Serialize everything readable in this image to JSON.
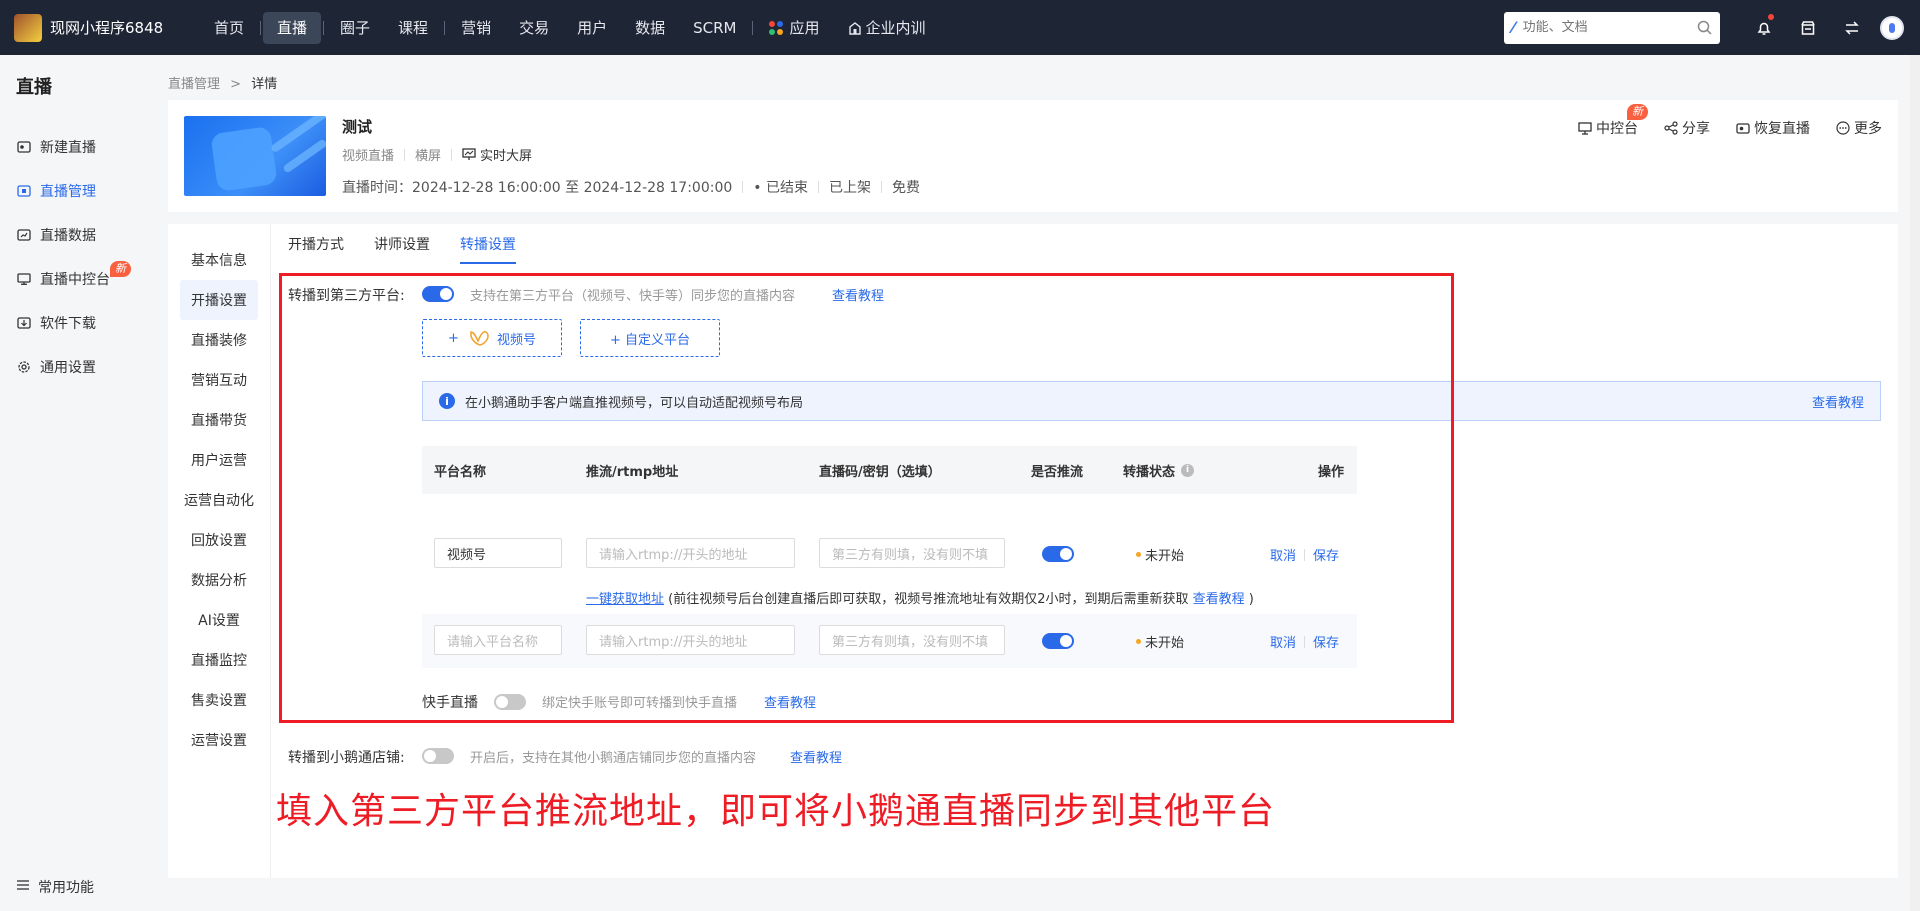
{
  "topbar": {
    "brand": "现网小程序6848",
    "nav": [
      {
        "label": "首页"
      },
      {
        "label": "直播",
        "active": true
      },
      {
        "label": "圈子"
      },
      {
        "label": "课程"
      },
      {
        "label": "营销"
      },
      {
        "label": "交易"
      },
      {
        "label": "用户"
      },
      {
        "label": "数据"
      },
      {
        "label": "SCRM"
      },
      {
        "label": "应用"
      },
      {
        "label": "企业内训"
      }
    ],
    "search_placeholder": "功能、文档"
  },
  "sidebar": {
    "title": "直播",
    "items": [
      {
        "label": "新建直播",
        "icon": "video-camera-icon"
      },
      {
        "label": "直播管理",
        "icon": "manage-icon",
        "active": true
      },
      {
        "label": "直播数据",
        "icon": "chart-icon"
      },
      {
        "label": "直播中控台",
        "icon": "monitor-icon",
        "badge": "新"
      },
      {
        "label": "软件下载",
        "icon": "download-icon"
      },
      {
        "label": "通用设置",
        "icon": "gear-icon"
      }
    ],
    "bottom": "常用功能"
  },
  "breadcrumb": {
    "parent": "直播管理",
    "sep": ">",
    "current": "详情"
  },
  "live": {
    "title": "测试",
    "type": "视频直播",
    "orientation": "横屏",
    "screen": "实时大屏",
    "time": "直播时间：2024-12-28 16:00:00 至 2024-12-28 17:00:00",
    "status": "• 已结束",
    "shelf": "已上架",
    "price": "免费",
    "actions": {
      "console": "中控台",
      "console_badge": "新",
      "share": "分享",
      "restore": "恢复直播",
      "more": "更多"
    }
  },
  "subnav": [
    "基本信息",
    "开播设置",
    "直播装修",
    "营销互动",
    "直播带货",
    "用户运营",
    "运营自动化",
    "回放设置",
    "数据分析",
    "AI设置",
    "直播监控",
    "售卖设置",
    "运营设置"
  ],
  "tabs": [
    {
      "label": "开播方式"
    },
    {
      "label": "讲师设置"
    },
    {
      "label": "转播设置",
      "active": true
    }
  ],
  "relay": {
    "label": "转播到第三方平台:",
    "desc": "支持在第三方平台（视频号、快手等）同步您的直播内容",
    "tutorial": "查看教程",
    "btn_channels": "视频号",
    "btn_custom": "+ 自定义平台",
    "plus": "+",
    "alert": "在小鹅通助手客户端直推视频号，可以自动适配视频号布局",
    "alert_link": "查看教程",
    "table": {
      "headers": [
        "平台名称",
        "推流/rtmp地址",
        "直播码/密钥（选填）",
        "是否推流",
        "转播状态",
        "操作"
      ],
      "rows": [
        {
          "name": "视频号",
          "name_placeholder": "",
          "rtmp_placeholder": "请输入rtmp://开头的地址",
          "key_placeholder": "第三方有则填，没有则不填",
          "status": "未开始",
          "cancel": "取消",
          "save": "保存"
        },
        {
          "name": "",
          "name_placeholder": "请输入平台名称",
          "rtmp_placeholder": "请输入rtmp://开头的地址",
          "key_placeholder": "第三方有则填，没有则不填",
          "status": "未开始",
          "cancel": "取消",
          "save": "保存"
        }
      ]
    },
    "hint_link": "一键获取地址",
    "hint_text": "(前往视频号后台创建直播后即可获取，视频号推流地址有效期仅2小时，到期后需重新获取",
    "hint_link2": "查看教程",
    "hint_end": ")",
    "kuaishou_label": "快手直播",
    "kuaishou_desc": "绑定快手账号即可转播到快手直播",
    "kuaishou_link": "查看教程"
  },
  "store_relay": {
    "label": "转播到小鹅通店铺:",
    "desc": "开启后，支持在其他小鹅通店铺同步您的直播内容",
    "link": "查看教程"
  },
  "caption": "填入第三方平台推流地址，即可将小鹅通直播同步到其他平台",
  "colors": {
    "accent": "#2a6ae9",
    "topbar": "#1e2535",
    "annotation": "#ee1c25"
  }
}
